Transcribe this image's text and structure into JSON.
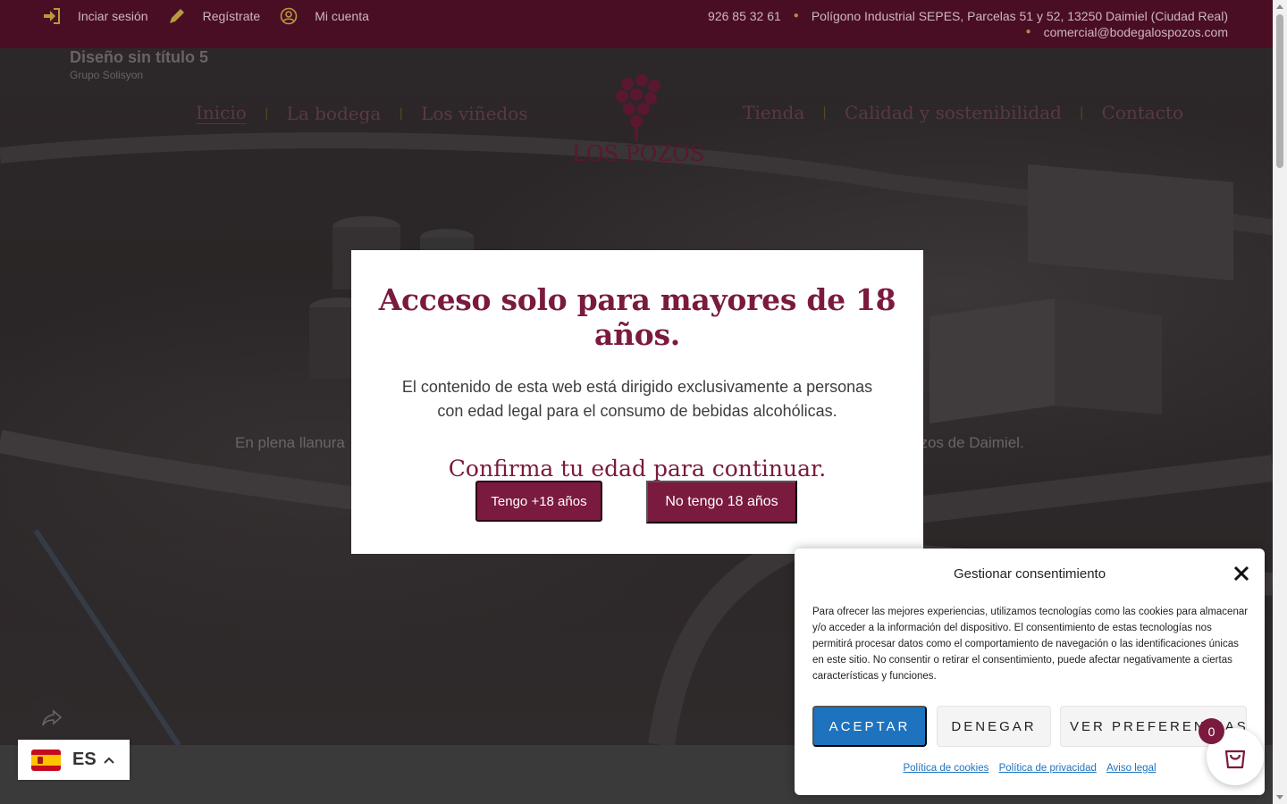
{
  "topbar": {
    "login": "Inciar sesión",
    "register": "Regístrate",
    "account": "Mi cuenta",
    "phone": "926 85 32 61",
    "address": "Polígono Industrial SEPES, Parcelas 51 y 52, 13250 Daimiel (Ciudad Real)",
    "email": "comercial@bodegalospozos.com"
  },
  "site": {
    "title": "Diseño sin título 5",
    "subtitle": "Grupo Solisyon"
  },
  "nav": {
    "left": [
      "Inicio",
      "La bodega",
      "Los viñedos"
    ],
    "right": [
      "Tienda",
      "Calidad y sostenibilidad",
      "Contacto"
    ]
  },
  "logo": {
    "text": "LOS POZOS",
    "color": "#6a1a34"
  },
  "hero": {
    "text_left": "En plena llanura",
    "text_right": "ozos de Daimiel."
  },
  "age_gate": {
    "title": "Acceso solo para mayores de 18 años.",
    "body": "El contenido de esta web está dirigido exclusivamente a personas con edad legal para el consumo de bebidas alcohólicas.",
    "confirm": "Confirma tu edad para continuar.",
    "yes_label": "Tengo +18 años",
    "no_label": "No tengo 18 años"
  },
  "consent": {
    "title": "Gestionar consentimiento",
    "text": "Para ofrecer las mejores experiencias, utilizamos tecnologías como las cookies para almacenar y/o acceder a la información del dispositivo. El consentimiento de estas tecnologías nos permitirá procesar datos como el comportamiento de navegación o las identificaciones únicas en este sitio. No consentir o retirar el consentimiento, puede afectar negativamente a ciertas características y funciones.",
    "accept_label": "ACEPTAR",
    "deny_label": "DENEGAR",
    "prefs_label": "VER PREFERENCIAS",
    "links": [
      "Política de cookies",
      "Política de privacidad",
      "Aviso legal"
    ]
  },
  "cart": {
    "count": "0"
  },
  "language": {
    "code": "ES"
  },
  "colors": {
    "brand": "#7a1a3e",
    "topbar": "#4a0e24",
    "accept": "#1e73be"
  }
}
